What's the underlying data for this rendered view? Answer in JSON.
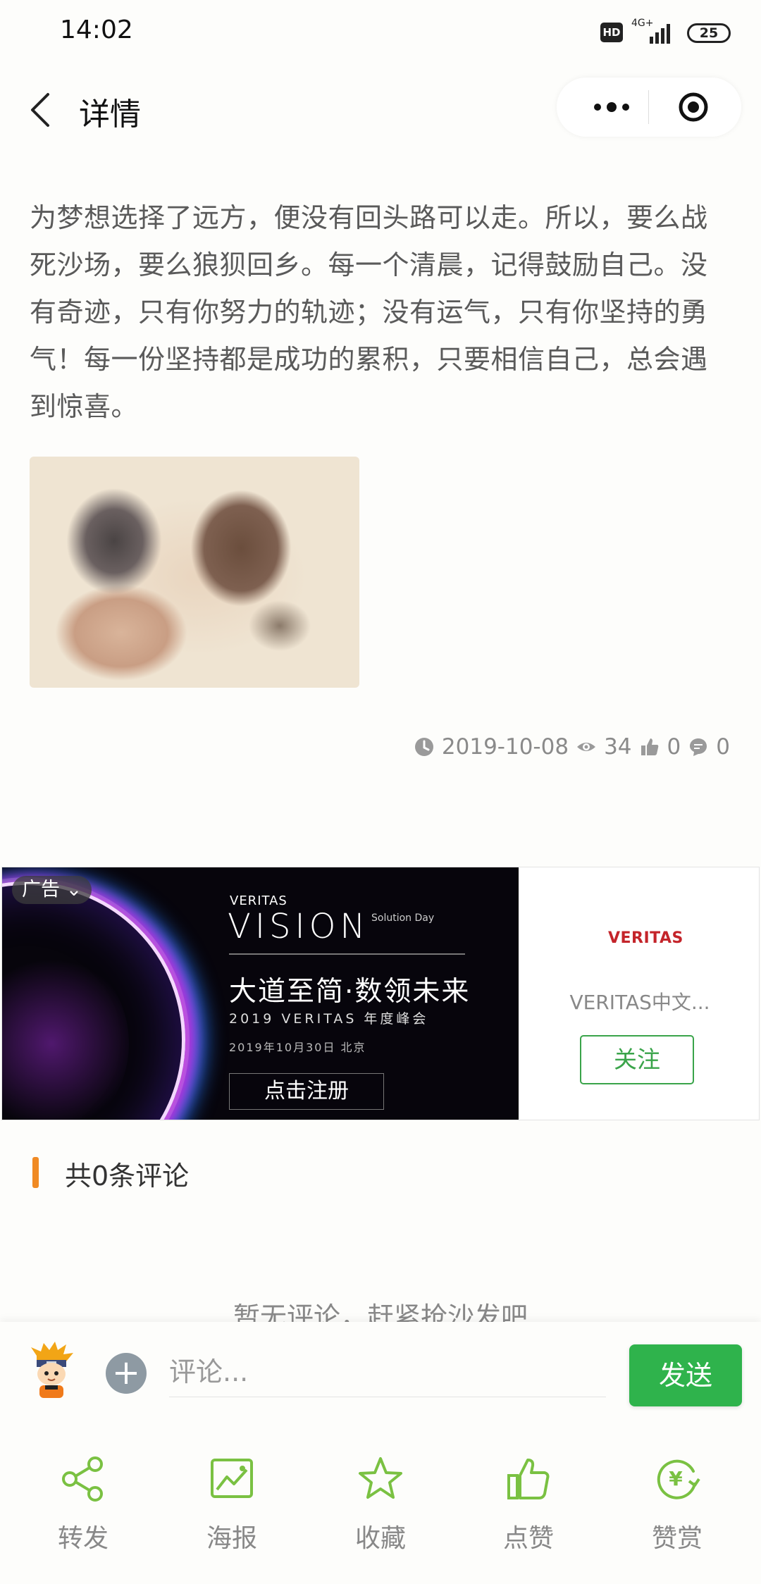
{
  "status_bar": {
    "time": "14:02",
    "hd": "HD",
    "network": "4G+",
    "battery": "25"
  },
  "nav": {
    "title": "详情"
  },
  "article": {
    "text": "为梦想选择了远方，便没有回头路可以走。所以，要么战死沙场，要么狼狈回乡。每一个清晨，记得鼓励自己。没有奇迹，只有你努力的轨迹；没有运气，只有你坚持的勇气！每一份坚持都是成功的累积，只要相信自己，总会遇到惊喜。",
    "date": "2019-10-08",
    "views": "34",
    "likes": "0",
    "comments": "0"
  },
  "ad": {
    "tag": "广告",
    "brand_small": "VERITAS",
    "vision": "VISION",
    "solution": "Solution Day",
    "slogan": "大道至简·数领未来",
    "sub": "2019 VERITAS 年度峰会",
    "date_place": "2019年10月30日 北京",
    "cta": "点击注册",
    "logo": "VERITAS",
    "account_name": "VERITAS中文...",
    "follow": "关注"
  },
  "comments": {
    "title": "共0条评论",
    "empty": "暂无评论，赶紧抢沙发吧",
    "placeholder": "评论...",
    "send": "发送"
  },
  "actions": [
    {
      "label": "转发",
      "icon": "share-icon"
    },
    {
      "label": "海报",
      "icon": "poster-icon"
    },
    {
      "label": "收藏",
      "icon": "star-icon"
    },
    {
      "label": "点赞",
      "icon": "thumbs-up-icon"
    },
    {
      "label": "赞赏",
      "icon": "reward-icon"
    }
  ],
  "colors": {
    "accent_green": "#2fb34c",
    "icon_green": "#7ac142",
    "orange_bar": "#f08a24",
    "veritas_red": "#c4242a"
  }
}
